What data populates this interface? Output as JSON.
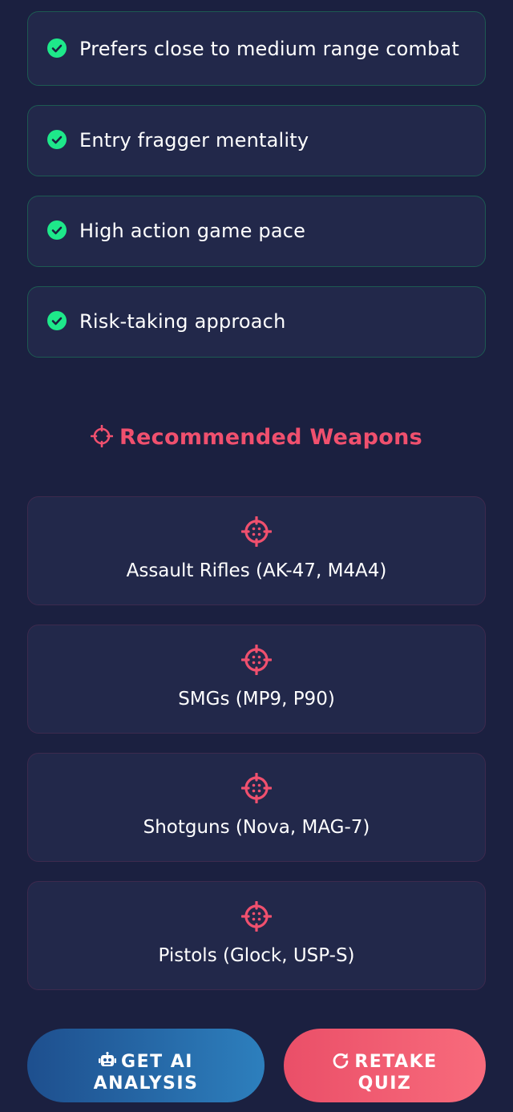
{
  "traits": [
    {
      "label": "Prefers close to medium range combat"
    },
    {
      "label": "Entry fragger mentality"
    },
    {
      "label": "High action game pace"
    },
    {
      "label": "Risk-taking approach"
    }
  ],
  "weapons_section": {
    "title": "Recommended Weapons",
    "icon": "crosshair-icon"
  },
  "weapons": [
    {
      "label": "Assault Rifles (AK-47, M4A4)",
      "icon": "crosshair-icon"
    },
    {
      "label": "SMGs (MP9, P90)",
      "icon": "crosshair-icon"
    },
    {
      "label": "Shotguns (Nova, MAG-7)",
      "icon": "crosshair-icon"
    },
    {
      "label": "Pistols (Glock, USP-S)",
      "icon": "crosshair-icon"
    }
  ],
  "actions": {
    "ai_analysis": {
      "line1": "GET AI",
      "line2": "ANALYSIS",
      "icon": "robot-icon"
    },
    "retake": {
      "line1": "RETAKE",
      "line2": "QUIZ",
      "icon": "redo-icon"
    }
  },
  "colors": {
    "background": "#1b2040",
    "card": "#22284a",
    "check_green": "#1ee88a",
    "accent_red": "#f0506e",
    "ai_button": "#2566a5",
    "retake_button": "#f25f73"
  }
}
